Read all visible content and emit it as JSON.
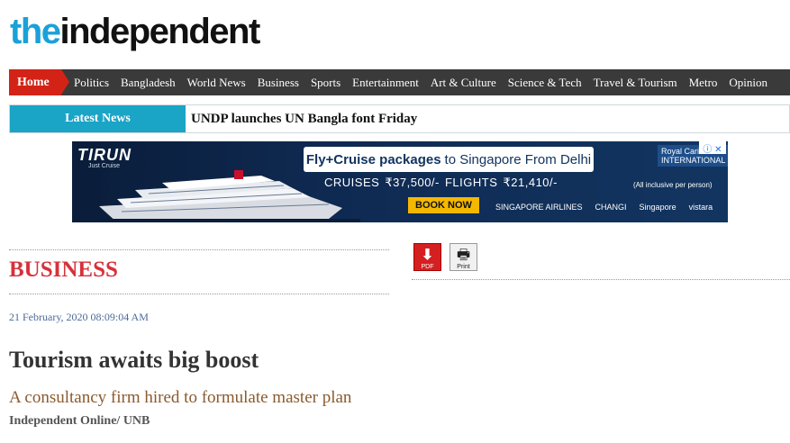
{
  "logo": {
    "part1": "the",
    "part2": "independent"
  },
  "nav": {
    "home": "Home",
    "items": [
      "Politics",
      "Bangladesh",
      "World News",
      "Business",
      "Sports",
      "Entertainment",
      "Art & Culture",
      "Science & Tech",
      "Travel & Tourism",
      "Metro",
      "Opinion"
    ]
  },
  "latest": {
    "label": "Latest News",
    "headline": "UNDP launches UN Bangla font Friday"
  },
  "ad": {
    "brand": "TIRUN",
    "brand_sub": "Just Cruise",
    "pill_bold": "Fly+Cruise packages",
    "pill_rest": "to Singapore From Delhi",
    "prices": "CRUISES ₹37,500/-   FLIGHTS ₹21,410/-",
    "cta": "BOOK NOW",
    "partners": [
      "SINGAPORE AIRLINES",
      "CHANGI",
      "Singapore",
      "vistara"
    ],
    "rc_label": "Royal Caribbean INTERNATIONAL",
    "all_inclusive": "(All inclusive per person)",
    "ad_badge": "ⓘ ✕"
  },
  "article": {
    "section": "BUSINESS",
    "date": "21 February, 2020 08:09:04 AM",
    "headline": "Tourism awaits big boost",
    "subhead": "A consultancy firm hired to formulate master plan",
    "byline": "Independent Online/ UNB"
  },
  "tools": {
    "pdf_label": "PDF",
    "print_label": "Print"
  },
  "colors": {
    "brand_blue": "#1aa1d8",
    "nav_bg": "#3a3a3a",
    "home_red": "#d32317",
    "section_red": "#d7313b",
    "latest_teal": "#1aa4c6"
  }
}
